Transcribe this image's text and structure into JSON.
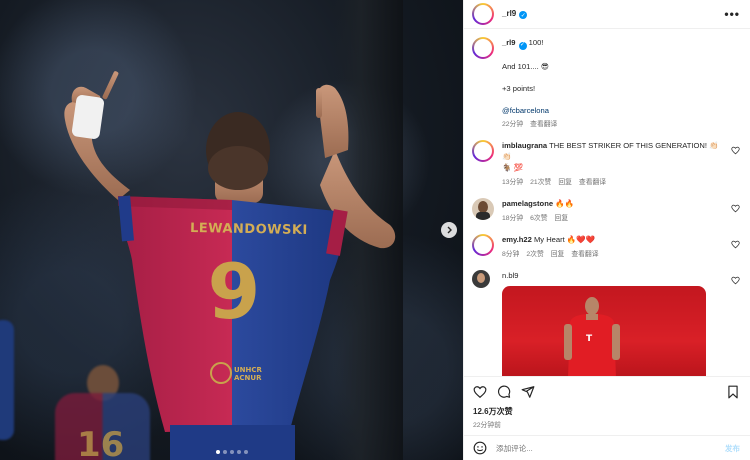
{
  "post": {
    "username": "_rl9",
    "verified": true,
    "more_label": "•••",
    "caption": {
      "line1": "100!",
      "line2": "And 101.... 😎",
      "line3": "+3 points!",
      "mention": "@fcbarcelona",
      "time": "22分钟",
      "translate": "查看翻译"
    },
    "media": {
      "jersey_name": "LEWANDOWSKI",
      "jersey_number": "9",
      "sponsor": "UNHCR ACNUR",
      "bg_number": "16",
      "dots_count": 5,
      "active_dot": 0
    },
    "comments": [
      {
        "username": "imblaugrana",
        "text": "THE BEST STRIKER OF THIS GENERATION! 👏🏻👏🏻",
        "text2": "🐐 💯",
        "time": "13分钟",
        "likes": "21次赞",
        "reply": "回复",
        "translate": "查看翻译"
      },
      {
        "username": "pamelagstone",
        "text": "🔥🔥",
        "time": "18分钟",
        "likes": "6次赞",
        "reply": "回复"
      },
      {
        "username": "emy.h22",
        "text": "My Heart 🔥❤️❤️",
        "time": "8分钟",
        "likes": "2次赞",
        "reply": "回复",
        "translate": "查看翻译"
      },
      {
        "username": "n.bl9"
      }
    ],
    "likes_count": "12.6万次赞",
    "posted_time": "22分钟前",
    "add_comment_placeholder": "添加评论...",
    "post_button": "发布"
  },
  "colors": {
    "verified_blue": "#0095f6",
    "link": "#00376b",
    "heart_red": "#ed4956"
  },
  "icons": [
    "heart-icon",
    "comment-icon",
    "share-icon",
    "bookmark-icon",
    "emoji-icon",
    "more-icon",
    "chevron-right-icon",
    "verified-icon"
  ]
}
